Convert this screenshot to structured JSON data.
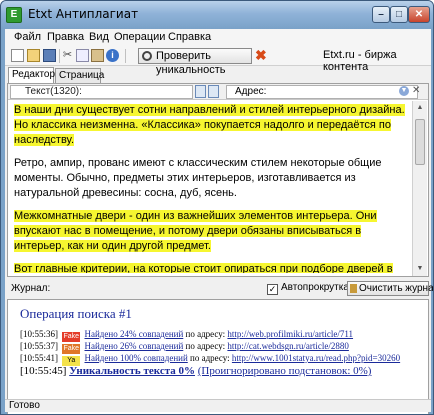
{
  "window": {
    "title": "Etxt Антиплагиат",
    "accent": "#7aa2c8"
  },
  "menu": [
    "Файл",
    "Правка",
    "Вид",
    "Операции",
    "Справка"
  ],
  "toolbar": {
    "check_label": "Проверить уникальность",
    "etxt_link": "Etxt.ru - биржа контента"
  },
  "tabs": [
    "Редактор",
    "Страница"
  ],
  "editor": {
    "text_count": "Текст(1320):",
    "address_label": "Адрес:",
    "address_value": "",
    "paragraphs": [
      {
        "text": "В наши дни существует сотни направлений и стилей интерьерного дизайна. Но классика неизменна. «Классика» покупается надолго и передаётся по наследству.",
        "highlight": true
      },
      {
        "text": "Ретро, ампир, прованс имеют с классическим стилем некоторые общие моменты. Обычно, предметы этих интерьеров, изготавливается из натуральной древесины: сосна, дуб, ясень.",
        "highlight": false
      },
      {
        "text": "Межкомнатные двери - один из важнейших элементов интерьера. Они впускают нас в помещение, и потому двери обязаны вписываться в интерьер, как ни один другой предмет.",
        "highlight": true
      },
      {
        "text": "Вот главные критерии, на которые стоит опираться при подборе дверей в классическом интерьере:",
        "highlight": true
      }
    ]
  },
  "journal": {
    "label": "Журнал:",
    "autoscroll_label": "Автопрокрутка",
    "autoscroll_checked": true,
    "clear_label": "Очистить журнал",
    "operation_title": "Операция поиска #1",
    "entries": [
      {
        "time": "[10:55:36]",
        "badge": "Fake",
        "badge_color": "#e43c2a",
        "found": "Найдено 24% совпадений",
        "by": "по адресу:",
        "url": "http://web.profilmiki.ru/article/711"
      },
      {
        "time": "[10:55:37]",
        "badge": "Fake",
        "badge_color": "#e07628",
        "found": "Найдено 26% совпадений",
        "by": "по адресу:",
        "url": "http://cat.webdsgn.ru/article/2880"
      },
      {
        "time": "[10:55:41]",
        "badge": "Ya",
        "badge_color": "#f4e24a",
        "found": "Найдено 100% совпадений",
        "by": "по адресу:",
        "url": "http://www.1001statya.ru/read.php?pid=30260"
      }
    ],
    "summary_time": "[10:55:45]",
    "summary_uniqueness": "Уникальность текста 0%",
    "summary_ignored": "(Проигнорировано подстановок: 0%)"
  },
  "status": "Готово"
}
